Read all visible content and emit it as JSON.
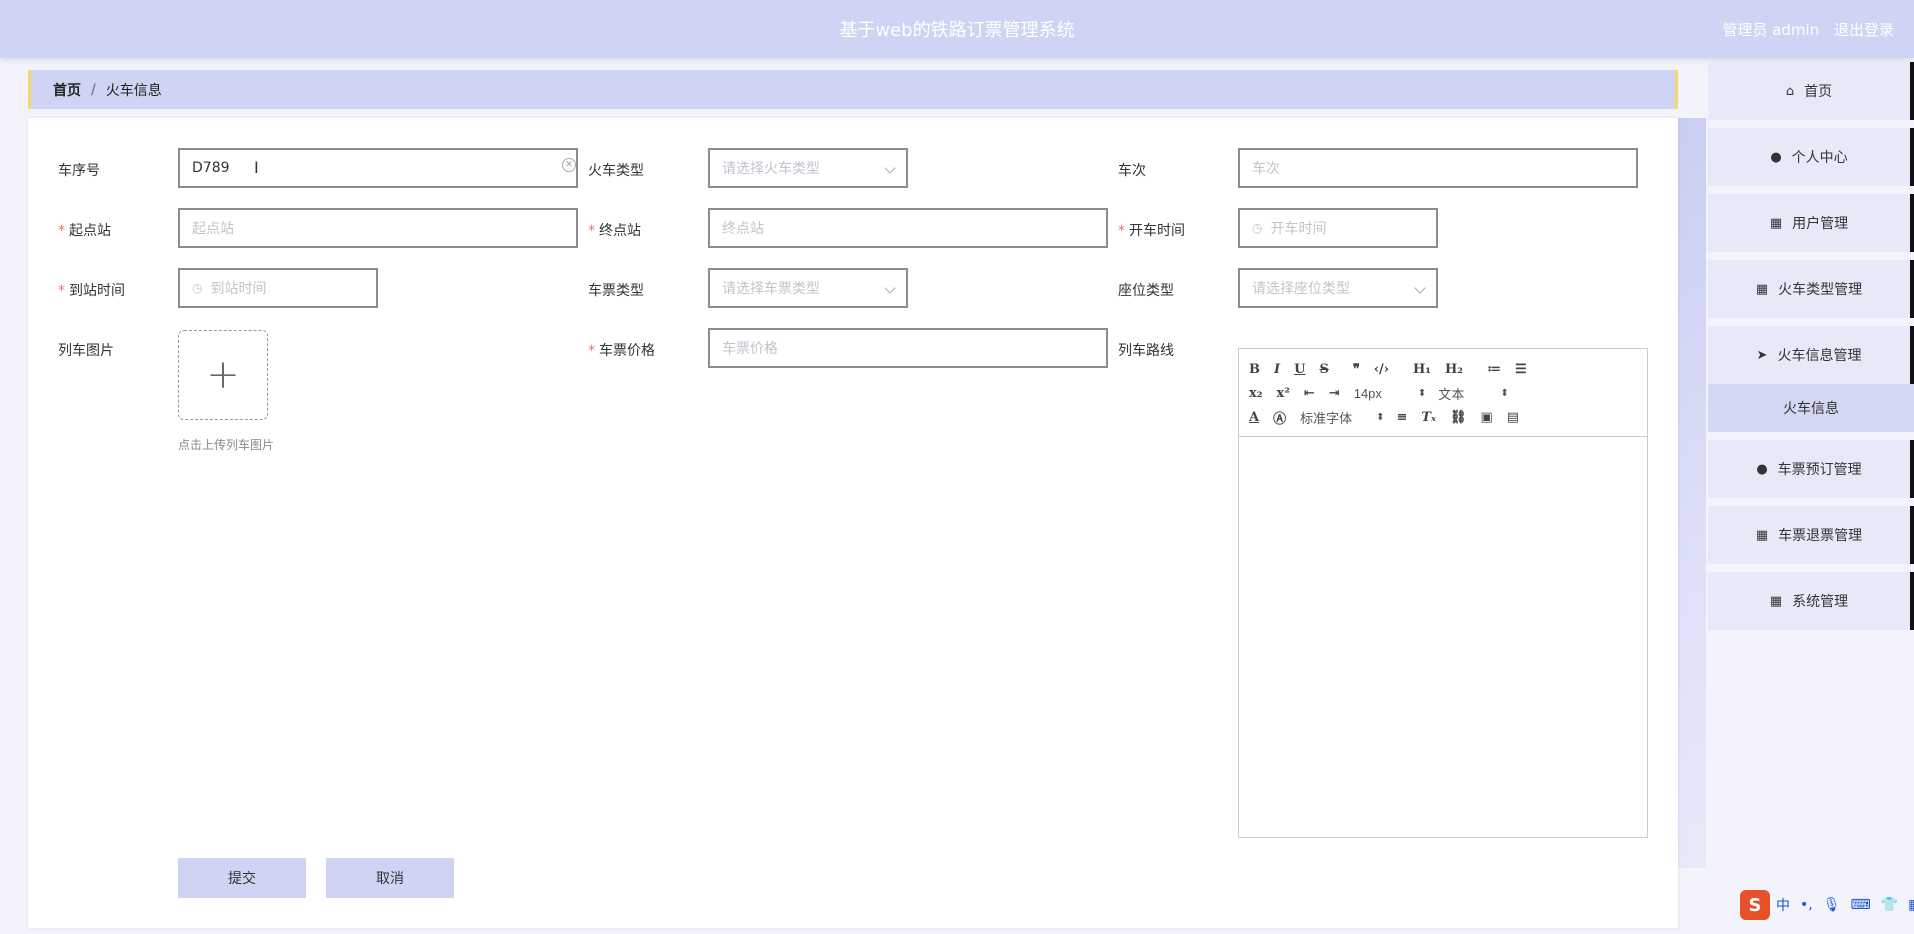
{
  "header": {
    "title": "基于web的铁路订票管理系统",
    "user_label": "管理员 admin",
    "logout": "退出登录"
  },
  "breadcrumb": {
    "home": "首页",
    "separator": "/",
    "current": "火车信息"
  },
  "form": {
    "train_no_label": "车序号",
    "train_no_value": "D789",
    "train_type_label": "火车类型",
    "train_type_placeholder": "请选择火车类型",
    "trip_label": "车次",
    "trip_placeholder": "车次",
    "start_label": "起点站",
    "start_placeholder": "起点站",
    "end_label": "终点站",
    "end_placeholder": "终点站",
    "depart_label": "开车时间",
    "depart_placeholder": "开车时间",
    "arrive_label": "到站时间",
    "arrive_placeholder": "到站时间",
    "ticket_type_label": "车票类型",
    "ticket_type_placeholder": "请选择车票类型",
    "seat_type_label": "座位类型",
    "seat_type_placeholder": "请选择座位类型",
    "image_label": "列车图片",
    "upload_tip": "点击上传列车图片",
    "price_label": "车票价格",
    "price_placeholder": "车票价格",
    "route_label": "列车路线",
    "required_mark": "*"
  },
  "editor": {
    "font_size": "14px",
    "text_type": "文本",
    "font_family": "标准字体"
  },
  "buttons": {
    "submit": "提交",
    "cancel": "取消"
  },
  "sidebar": {
    "items": [
      {
        "icon": "home-icon",
        "label": "首页"
      },
      {
        "icon": "user-icon",
        "label": "个人中心"
      },
      {
        "icon": "grid-icon",
        "label": "用户管理"
      },
      {
        "icon": "grid-icon",
        "label": "火车类型管理"
      },
      {
        "icon": "send-icon",
        "label": "火车信息管理"
      },
      {
        "icon": "user-icon",
        "label": "车票预订管理"
      },
      {
        "icon": "grid-icon",
        "label": "车票退票管理"
      },
      {
        "icon": "grid-icon",
        "label": "系统管理"
      }
    ],
    "sub_item": "火车信息"
  },
  "ime": {
    "mode": "中"
  },
  "colors": {
    "header": "#cfd4f4",
    "accent_border": "#f5d76e",
    "required": "#f56c6c"
  }
}
